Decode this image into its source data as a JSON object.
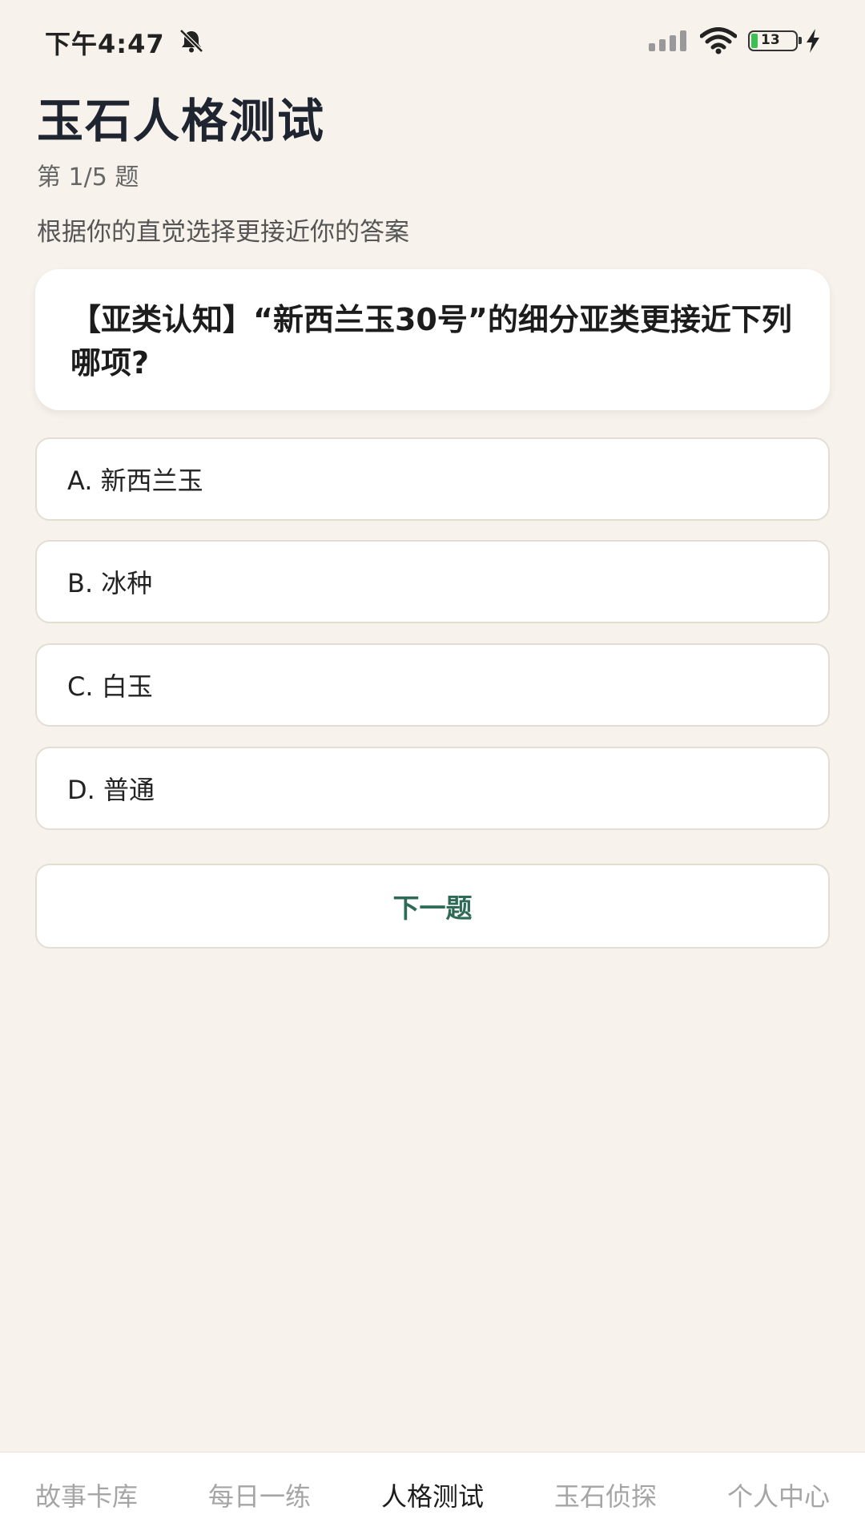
{
  "status_bar": {
    "time": "下午4:47",
    "mute_icon": "bell-slash-icon",
    "signal_icon": "cellular-signal-icon",
    "wifi_icon": "wifi-icon",
    "battery_level": "13",
    "battery_color": "#3dbf55",
    "charging_icon": "lightning-icon"
  },
  "header": {
    "title": "玉石人格测试",
    "counter": "第 1/5 题",
    "instruction": "根据你的直觉选择更接近你的答案"
  },
  "question": {
    "text": "【亚类认知】“新西兰玉30号”的细分亚类更接近下列哪项?"
  },
  "options": [
    {
      "label": "A. 新西兰玉"
    },
    {
      "label": "B. 冰种"
    },
    {
      "label": "C. 白玉"
    },
    {
      "label": "D. 普通"
    }
  ],
  "next_button": {
    "label": "下一题",
    "color": "#2e6b57"
  },
  "bottom_nav": {
    "items": [
      {
        "label": "故事卡库",
        "active": false
      },
      {
        "label": "每日一练",
        "active": false
      },
      {
        "label": "人格测试",
        "active": true
      },
      {
        "label": "玉石侦探",
        "active": false
      },
      {
        "label": "个人中心",
        "active": false
      }
    ]
  }
}
